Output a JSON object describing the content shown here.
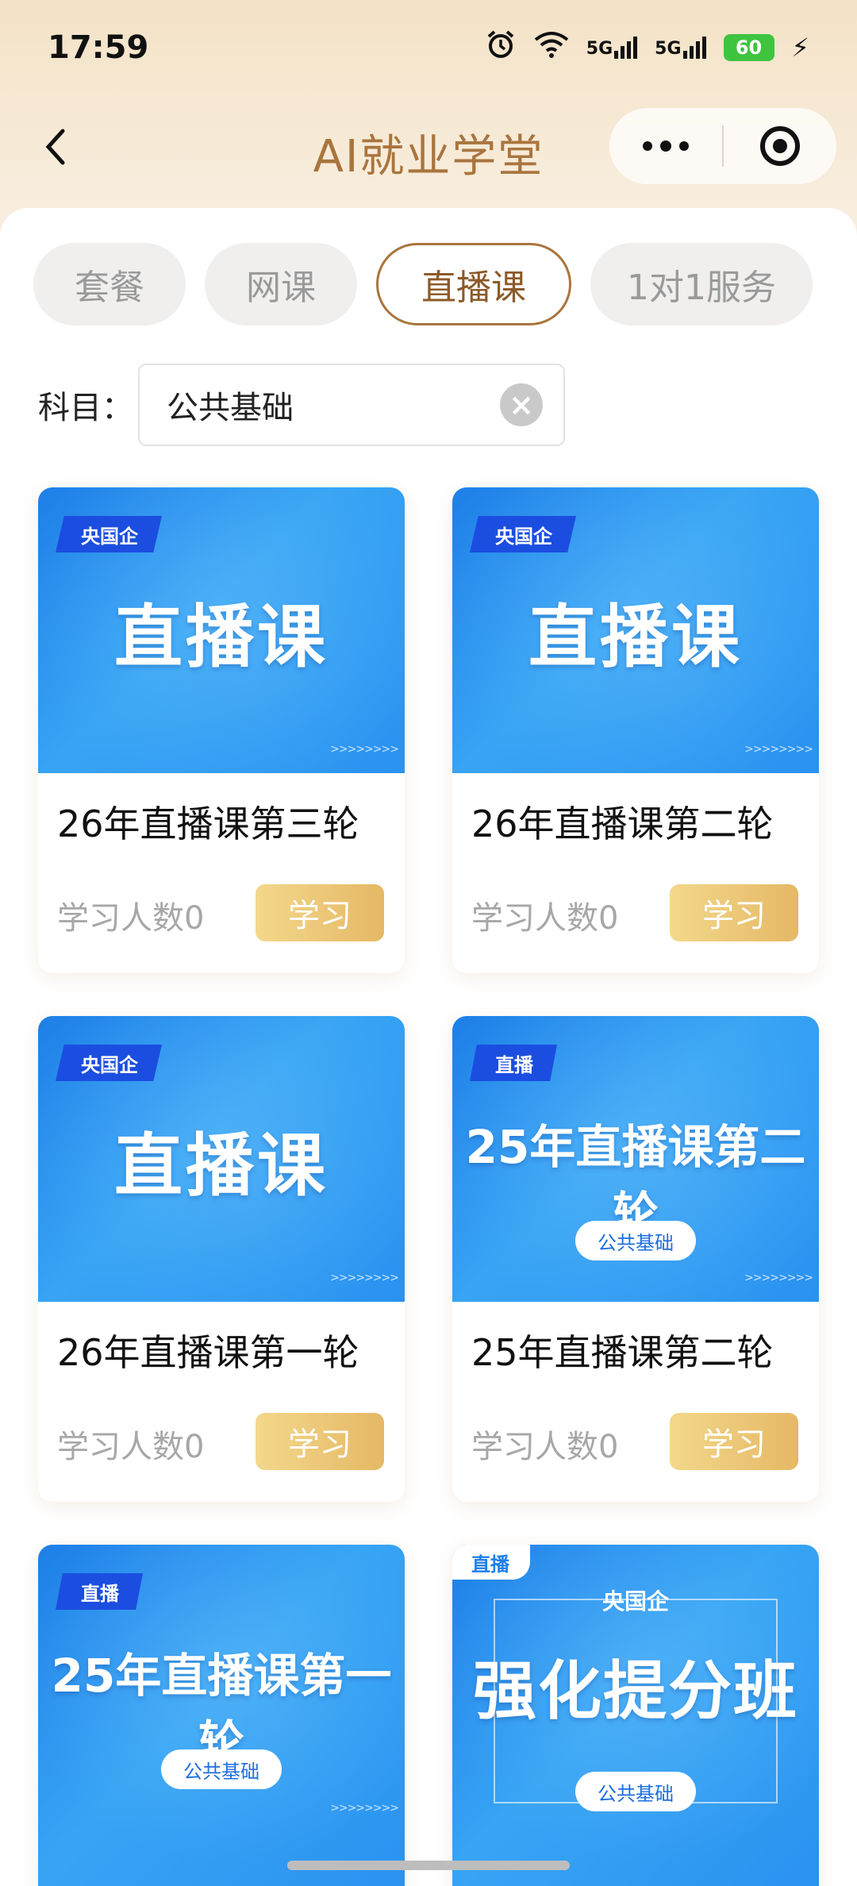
{
  "status": {
    "time": "17:59",
    "net1": "5G",
    "net2": "5G",
    "battery": "60"
  },
  "nav": {
    "title": "AI就业学堂"
  },
  "tabs": [
    {
      "label": "套餐",
      "active": false
    },
    {
      "label": "网课",
      "active": false
    },
    {
      "label": "直播课",
      "active": true
    },
    {
      "label": "1对1服务",
      "active": false
    }
  ],
  "subject": {
    "label": "科目：",
    "value": "公共基础"
  },
  "courses": [
    {
      "tag": "央国企",
      "thumb_title": "直播课",
      "name": "26年直播课第三轮",
      "count": "学习人数0",
      "button": "学习"
    },
    {
      "tag": "央国企",
      "thumb_title": "直播课",
      "name": "26年直播课第二轮",
      "count": "学习人数0",
      "button": "学习"
    },
    {
      "tag": "央国企",
      "thumb_title": "直播课",
      "name": "26年直播课第一轮",
      "count": "学习人数0",
      "button": "学习"
    },
    {
      "tag": "直播",
      "thumb_title": "25年直播课第二轮",
      "pill": "公共基础",
      "name": "25年直播课第二轮",
      "count": "学习人数0",
      "button": "学习"
    },
    {
      "tag": "直播",
      "thumb_title": "25年直播课第一轮",
      "pill": "公共基础"
    },
    {
      "tag": "直播",
      "kicker": "央国企",
      "thumb_title": "强化提分班",
      "pill": "公共基础"
    }
  ],
  "colors": {
    "accent": "#a9753e",
    "thumb_blue": "#2a92f0",
    "tag_blue": "#1b4ee0",
    "button_gold": "#e5b865"
  }
}
